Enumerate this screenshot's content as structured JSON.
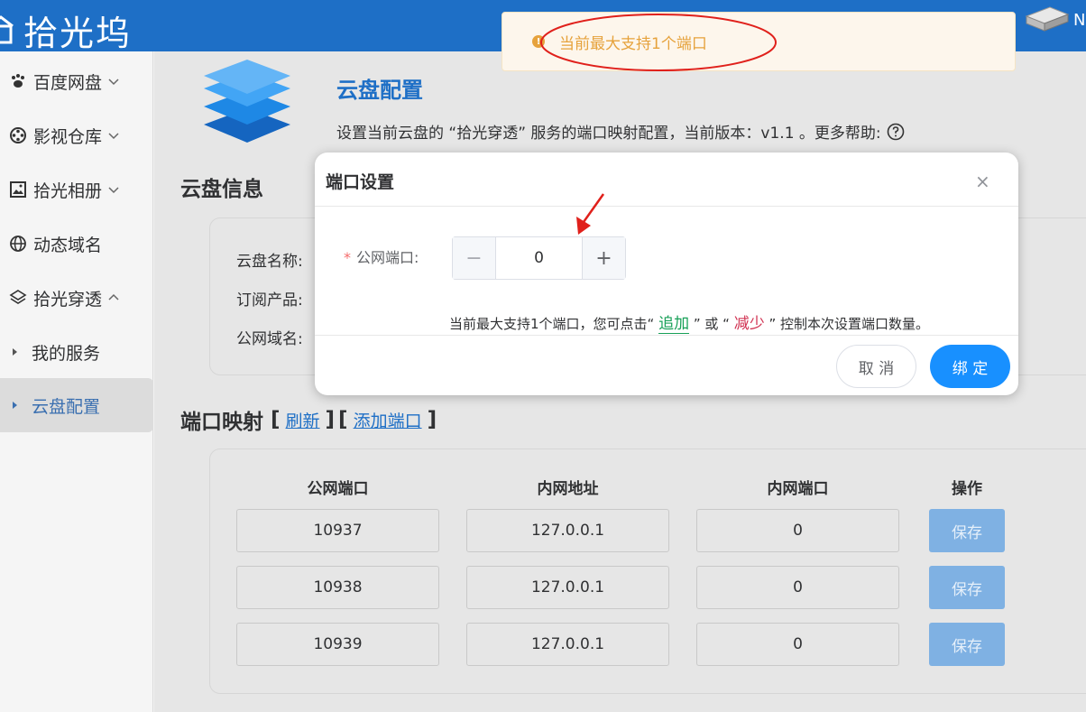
{
  "app": {
    "brand": "拾光坞",
    "user_initial": "N"
  },
  "sidebar": {
    "items": [
      {
        "label": "百度网盘",
        "icon": "paw-icon",
        "chevron": "down"
      },
      {
        "label": "影视仓库",
        "icon": "film-reel-icon",
        "chevron": "down"
      },
      {
        "label": "拾光相册",
        "icon": "image-icon",
        "chevron": "down"
      },
      {
        "label": "动态域名",
        "icon": "globe-icon",
        "chevron": ""
      },
      {
        "label": "拾光穿透",
        "icon": "layers-icon",
        "chevron": "up"
      }
    ],
    "subitems": [
      {
        "label": "我的服务",
        "active": false
      },
      {
        "label": "云盘配置",
        "active": true
      }
    ]
  },
  "header": {
    "title": "云盘配置",
    "description": "设置当前云盘的 “拾光穿透” 服务的端口映射配置，当前版本：v1.1 。更多帮助:"
  },
  "info": {
    "title": "云盘信息",
    "labels": [
      "云盘名称:",
      "订阅产品:",
      "公网域名:"
    ]
  },
  "mapping": {
    "title": "端口映射",
    "bracket_open": "[",
    "bracket_close": "]",
    "refresh": "刷新",
    "add_port": "添加端口",
    "columns": [
      "公网端口",
      "内网地址",
      "内网端口",
      "操作"
    ],
    "rows": [
      {
        "public_port": "10937",
        "internal_address": "127.0.0.1",
        "internal_port": "0",
        "action": "保存"
      },
      {
        "public_port": "10938",
        "internal_address": "127.0.0.1",
        "internal_port": "0",
        "action": "保存"
      },
      {
        "public_port": "10939",
        "internal_address": "127.0.0.1",
        "internal_port": "0",
        "action": "保存"
      }
    ]
  },
  "toast": {
    "type": "warning",
    "text": "当前最大支持1个端口",
    "icon_glyph": "!"
  },
  "dialog": {
    "title": "端口设置",
    "close": "×",
    "field_label": "公网端口:",
    "required_mark": "*",
    "stepper": {
      "value": "0",
      "minus": "−",
      "plus": "+"
    },
    "hint": {
      "before": "当前最大支持1个端口，您可点击“ ",
      "add": "追加",
      "middle": " ” 或 “ ",
      "reduce": "减少",
      "after": " ” 控制本次设置端口数量。"
    },
    "cancel": "取 消",
    "confirm": "绑 定"
  },
  "colors": {
    "primary": "#1e6fc6",
    "confirm": "#1890ff",
    "warning": "#e6a23c",
    "annotation": "#e0201b",
    "add": "#18a058",
    "reduce": "#d03050"
  }
}
